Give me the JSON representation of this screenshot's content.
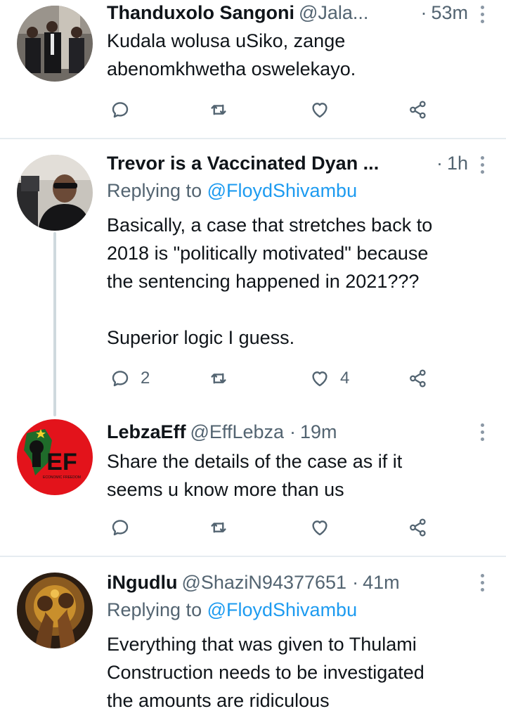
{
  "tweets": [
    {
      "name": "Thanduxolo Sangoni",
      "handle": "@Jala...",
      "dot": "·",
      "time": "53m",
      "reply_label": "",
      "reply_mention": "",
      "body": "Kudala wolusa uSiko, zange\nabenomkhwetha oswelekayo.",
      "reply_count": "",
      "like_count": "",
      "avatar": "photo-men-in-suits"
    },
    {
      "name": "Trevor is a Vaccinated Dyan ...",
      "handle": "",
      "dot": "·",
      "time": "1h",
      "reply_label": "Replying to ",
      "reply_mention": "@FloydShivambu",
      "body": "Basically, a case that stretches back to\n2018 is \"politically motivated\" because\nthe sentencing happened in 2021???\n\nSuperior logic I guess.",
      "reply_count": "2",
      "like_count": "4",
      "avatar": "photo-man-in-car"
    },
    {
      "name": "LebzaEff",
      "handle": "@EffLebza",
      "dot": "·",
      "time": "19m",
      "reply_label": "",
      "reply_mention": "",
      "body": "Share the details of the case as if it\nseems u know more than us",
      "reply_count": "",
      "like_count": "",
      "avatar": "eff-logo",
      "avatar_text": "EF",
      "avatar_small_text": "ECONOMIC FREEDOM"
    },
    {
      "name": "iNgudlu",
      "handle": "@ShaziN94377651",
      "dot": "·",
      "time": "41m",
      "reply_label": "Replying to ",
      "reply_mention": "@FloydShivambu",
      "body": "Everything that was given to Thulami\nConstruction needs to be investigated\nthe amounts are ridiculous",
      "reply_count": "",
      "like_count": "",
      "avatar": "photo-boxing-art"
    }
  ],
  "icons": [
    "reply-icon",
    "retweet-icon",
    "like-icon",
    "share-icon",
    "more-icon"
  ],
  "colors": {
    "link": "#1d9bf0",
    "secondary": "#536471",
    "separator": "#e6ecf0",
    "eff_red": "#e3131b"
  }
}
